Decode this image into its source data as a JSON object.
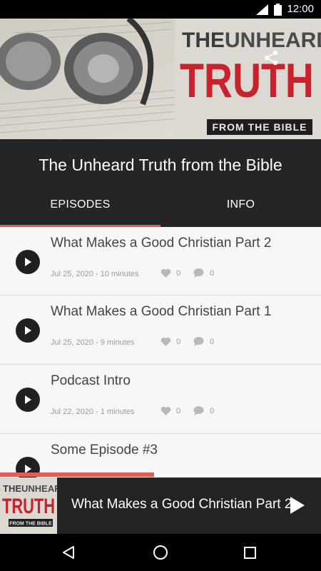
{
  "status_bar": {
    "time": "12:00"
  },
  "artwork": {
    "logo_line1_a": "THE",
    "logo_line1_b": "UNHEARD",
    "logo_line2": "TRUTH",
    "logo_line3": "FROM THE BIBLE"
  },
  "podcast": {
    "title": "The Unheard Truth from the Bible"
  },
  "tabs": [
    {
      "label": "EPISODES",
      "active": true
    },
    {
      "label": "INFO",
      "active": false
    }
  ],
  "episodes": [
    {
      "title": "What Makes a Good Christian Part 2",
      "meta": "Jul 25, 2020 - 10 minutes",
      "likes": "0",
      "comments": "0"
    },
    {
      "title": "What Makes a Good Christian Part 1",
      "meta": "Jul 25, 2020 - 9 minutes",
      "likes": "0",
      "comments": "0"
    },
    {
      "title": "Podcast Intro",
      "meta": "Jul 22, 2020 - 1 minutes",
      "likes": "0",
      "comments": "0"
    },
    {
      "title": "Some Episode #3",
      "meta": "",
      "likes": "",
      "comments": ""
    }
  ],
  "now_playing": {
    "title": "What Makes a Good Christian Part 2",
    "progress": 0.48
  },
  "colors": {
    "accent": "#e85a55",
    "dark": "#252525",
    "logo_red": "#c8232c"
  },
  "icons": {
    "status": [
      "wifi-icon",
      "signal-icon",
      "battery-icon"
    ],
    "header": "share-icon",
    "episode": [
      "play-icon",
      "heart-icon",
      "comment-icon"
    ],
    "nav": [
      "back-icon",
      "home-icon",
      "recents-icon"
    ]
  }
}
